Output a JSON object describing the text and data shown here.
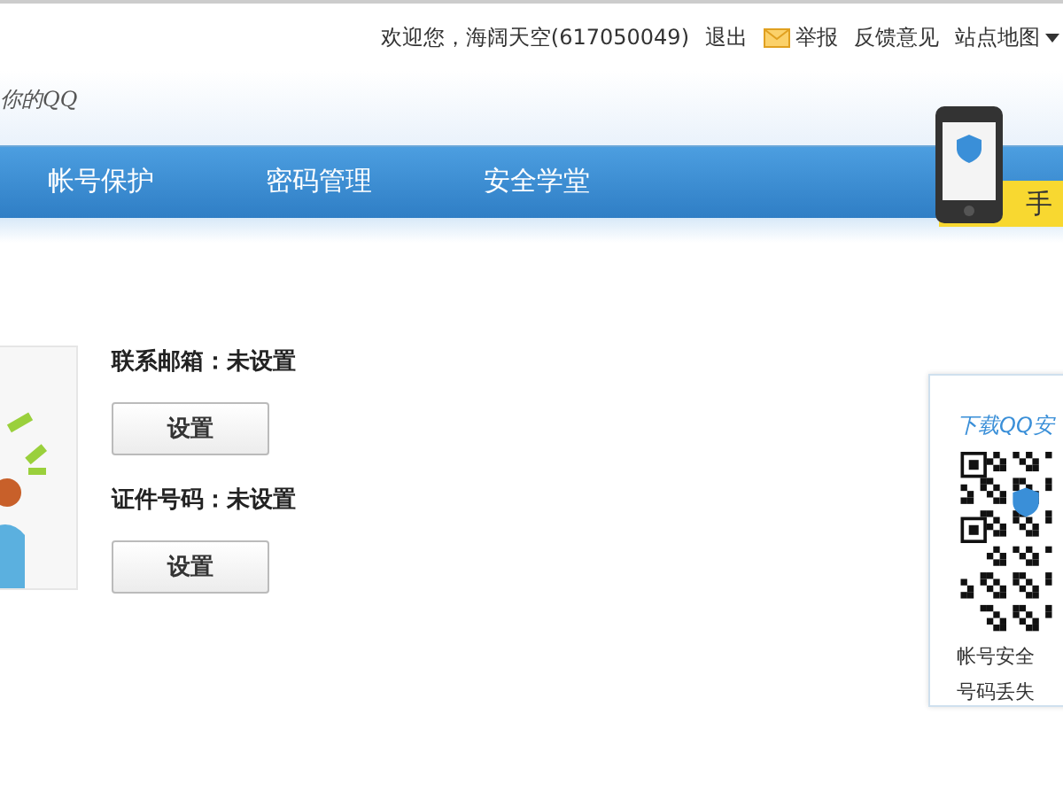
{
  "top_bar": {
    "welcome": "欢迎您，海阔天空(617050049)",
    "links": [
      {
        "label": "退出",
        "kind": "text"
      },
      {
        "label": "举报",
        "kind": "mail"
      },
      {
        "label": "反馈意见",
        "kind": "text"
      },
      {
        "label": "站点地图",
        "kind": "dropdown"
      }
    ]
  },
  "header": {
    "slogan": "你的QQ",
    "promo": "手"
  },
  "nav": {
    "tabs": [
      {
        "label": "帐号保护",
        "selected": false
      },
      {
        "label": "密码管理",
        "selected": false
      },
      {
        "label": "安全学堂",
        "selected": false
      }
    ]
  },
  "settings": [
    {
      "label": "联系邮箱：未设置",
      "button": "设置"
    },
    {
      "label": "证件号码：未设置",
      "button": "设置"
    }
  ],
  "qr_card": {
    "title": "下载QQ安",
    "lines": [
      "帐号安全",
      "号码丢失"
    ]
  }
}
